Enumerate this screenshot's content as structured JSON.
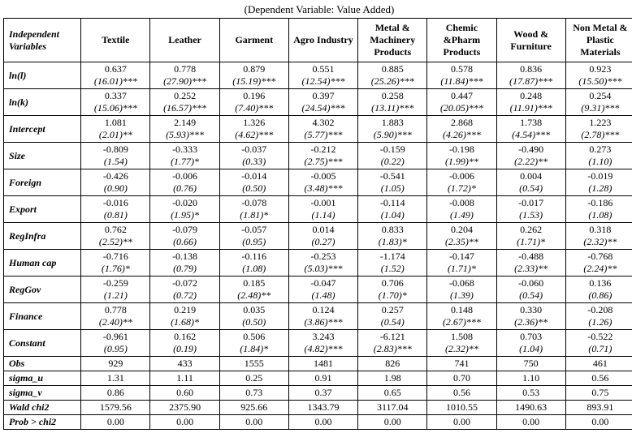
{
  "caption": "(Dependent Variable: Value Added)",
  "header": {
    "varcol": "Independent Variables",
    "cols": [
      "Textile",
      "Leather",
      "Garment",
      "Agro Industry",
      "Metal & Machinery Products",
      "Chemic &Pharm Products",
      "Wood & Furniture",
      "Non Metal & Plastic Materials"
    ]
  },
  "rows": [
    {
      "name": "ln(l)",
      "cells": [
        {
          "c": "0.637",
          "s": "(16.01)***"
        },
        {
          "c": "0.778",
          "s": "(27.90)***"
        },
        {
          "c": "0.879",
          "s": "(15.19)***"
        },
        {
          "c": "0.551",
          "s": "(12.54)***"
        },
        {
          "c": "0.885",
          "s": "(25.26)***"
        },
        {
          "c": "0.578",
          "s": "(11.84)***"
        },
        {
          "c": "0.836",
          "s": "(17.87)***"
        },
        {
          "c": "0.923",
          "s": "(15.50)***"
        }
      ]
    },
    {
      "name": "ln(k)",
      "cells": [
        {
          "c": "0.337",
          "s": "(15.06)***"
        },
        {
          "c": "0.252",
          "s": "(16.57)***"
        },
        {
          "c": "0.196",
          "s": "(7.40)***"
        },
        {
          "c": "0.397",
          "s": "(24.54)***"
        },
        {
          "c": "0.258",
          "s": "(13.11)***"
        },
        {
          "c": "0.447",
          "s": "(20.05)***"
        },
        {
          "c": "0.248",
          "s": "(11.91)***"
        },
        {
          "c": "0.254",
          "s": "(9.31)***"
        }
      ]
    },
    {
      "name": "Intercept",
      "cells": [
        {
          "c": "1.081",
          "s": "(2.01)**"
        },
        {
          "c": "2.149",
          "s": "(5.93)***"
        },
        {
          "c": "1.326",
          "s": "(4.62)***"
        },
        {
          "c": "4.302",
          "s": "(5.77)***"
        },
        {
          "c": "1.883",
          "s": "(5.90)***"
        },
        {
          "c": "2.868",
          "s": "(4.26)***"
        },
        {
          "c": "1.738",
          "s": "(4.54)***"
        },
        {
          "c": "1.223",
          "s": "(2.78)***"
        }
      ]
    },
    {
      "name": "Size",
      "cells": [
        {
          "c": "-0.809",
          "s": "(1.54)"
        },
        {
          "c": "-0.333",
          "s": "(1.77)*"
        },
        {
          "c": "-0.037",
          "s": "(0.33)"
        },
        {
          "c": "-0.212",
          "s": "(2.75)***"
        },
        {
          "c": "-0.159",
          "s": "(0.22)"
        },
        {
          "c": "-0.198",
          "s": "(1.99)**"
        },
        {
          "c": "-0.490",
          "s": "(2.22)**"
        },
        {
          "c": "0.273",
          "s": "(1.10)"
        }
      ]
    },
    {
      "name": "Foreign",
      "cells": [
        {
          "c": "-0.426",
          "s": "(0.90)"
        },
        {
          "c": "-0.006",
          "s": "(0.76)"
        },
        {
          "c": "-0.014",
          "s": "(0.50)"
        },
        {
          "c": "-0.005",
          "s": "(3.48)***"
        },
        {
          "c": "-0.541",
          "s": "(1.05)"
        },
        {
          "c": "-0.006",
          "s": "(1.72)*"
        },
        {
          "c": "0.004",
          "s": "(0.54)"
        },
        {
          "c": "-0.019",
          "s": "(1.28)"
        }
      ]
    },
    {
      "name": "Export",
      "cells": [
        {
          "c": "-0.016",
          "s": "(0.81)"
        },
        {
          "c": "-0.020",
          "s": "(1.95)*"
        },
        {
          "c": "-0.078",
          "s": "(1.81)*"
        },
        {
          "c": "-0.001",
          "s": "(1.14)"
        },
        {
          "c": "-0.114",
          "s": "(1.04)"
        },
        {
          "c": "-0.008",
          "s": "(1.49)"
        },
        {
          "c": "-0.017",
          "s": "(1.53)"
        },
        {
          "c": "-0.186",
          "s": "(1.08)"
        }
      ]
    },
    {
      "name": "RegInfra",
      "cells": [
        {
          "c": "0.762",
          "s": "(2.52)**"
        },
        {
          "c": "-0.079",
          "s": "(0.66)"
        },
        {
          "c": "-0.057",
          "s": "(0.95)"
        },
        {
          "c": "0.014",
          "s": "(0.27)"
        },
        {
          "c": "0.833",
          "s": "(1.83)*"
        },
        {
          "c": "0.204",
          "s": "(2.35)**"
        },
        {
          "c": "0.262",
          "s": "(1.71)*"
        },
        {
          "c": "0.318",
          "s": "(2.32)**"
        }
      ]
    },
    {
      "name": "Human cap",
      "cells": [
        {
          "c": "-0.716",
          "s": "(1.76)*"
        },
        {
          "c": "-0.138",
          "s": "(0.79)"
        },
        {
          "c": "-0.116",
          "s": "(1.08)"
        },
        {
          "c": "-0.253",
          "s": "(5.03)***"
        },
        {
          "c": "-1.174",
          "s": "(1.52)"
        },
        {
          "c": "-0.147",
          "s": "(1.71)*"
        },
        {
          "c": "-0.488",
          "s": "(2.33)**"
        },
        {
          "c": "-0.768",
          "s": "(2.24)**"
        }
      ]
    },
    {
      "name": "RegGov",
      "cells": [
        {
          "c": "-0.259",
          "s": "(1.21)"
        },
        {
          "c": "-0.072",
          "s": "(0.72)"
        },
        {
          "c": "0.185",
          "s": "(2.48)**"
        },
        {
          "c": "-0.047",
          "s": "(1.48)"
        },
        {
          "c": "0.706",
          "s": "(1.70)*"
        },
        {
          "c": "-0.068",
          "s": "(1.39)"
        },
        {
          "c": "-0.060",
          "s": "(0.54)"
        },
        {
          "c": "0.136",
          "s": "(0.86)"
        }
      ]
    },
    {
      "name": "Finance",
      "cells": [
        {
          "c": "0.778",
          "s": "(2.40)**"
        },
        {
          "c": "0.219",
          "s": "(1.68)*"
        },
        {
          "c": "0.035",
          "s": "(0.50)"
        },
        {
          "c": "0.124",
          "s": "(3.86)***"
        },
        {
          "c": "0.257",
          "s": "(0.54)"
        },
        {
          "c": "0.148",
          "s": "(2.67)***"
        },
        {
          "c": "0.330",
          "s": "(2.36)**"
        },
        {
          "c": "-0.208",
          "s": "(1.26)"
        }
      ]
    },
    {
      "name": "Constant",
      "cells": [
        {
          "c": "-0.961",
          "s": "(0.95)"
        },
        {
          "c": "0.162",
          "s": "(0.19)"
        },
        {
          "c": "0.506",
          "s": "(1.84)*"
        },
        {
          "c": "3.243",
          "s": "(4.82)***"
        },
        {
          "c": "-6.121",
          "s": "(2.83)***"
        },
        {
          "c": "1.508",
          "s": "(2.32)**"
        },
        {
          "c": "0.703",
          "s": "(1.04)"
        },
        {
          "c": "-0.522",
          "s": "(0.71)"
        }
      ]
    },
    {
      "name": "Obs",
      "single": true,
      "cells": [
        {
          "c": "929"
        },
        {
          "c": "433"
        },
        {
          "c": "1555"
        },
        {
          "c": "1481"
        },
        {
          "c": "826"
        },
        {
          "c": "741"
        },
        {
          "c": "750"
        },
        {
          "c": "461"
        }
      ]
    },
    {
      "name": "sigma_u",
      "single": true,
      "cells": [
        {
          "c": "1.31"
        },
        {
          "c": "1.11"
        },
        {
          "c": "0.25"
        },
        {
          "c": "0.91"
        },
        {
          "c": "1.98"
        },
        {
          "c": "0.70"
        },
        {
          "c": "1.10"
        },
        {
          "c": "0.56"
        }
      ]
    },
    {
      "name": "sigma_v",
      "single": true,
      "cells": [
        {
          "c": "0.86"
        },
        {
          "c": "0.60"
        },
        {
          "c": "0.73"
        },
        {
          "c": "0.37"
        },
        {
          "c": "0.65"
        },
        {
          "c": "0.56"
        },
        {
          "c": "0.53"
        },
        {
          "c": "0.75"
        }
      ]
    },
    {
      "name": "Wald chi2",
      "single": true,
      "cells": [
        {
          "c": "1579.56"
        },
        {
          "c": "2375.90"
        },
        {
          "c": "925.66"
        },
        {
          "c": "1343.79"
        },
        {
          "c": "3117.04"
        },
        {
          "c": "1010.55"
        },
        {
          "c": "1490.63"
        },
        {
          "c": "893.91"
        }
      ]
    },
    {
      "name": "Prob > chi2",
      "single": true,
      "cells": [
        {
          "c": "0.00"
        },
        {
          "c": "0.00"
        },
        {
          "c": "0.00"
        },
        {
          "c": "0.00"
        },
        {
          "c": "0.00"
        },
        {
          "c": "0.00"
        },
        {
          "c": "0.00"
        },
        {
          "c": "0.00"
        }
      ]
    }
  ]
}
